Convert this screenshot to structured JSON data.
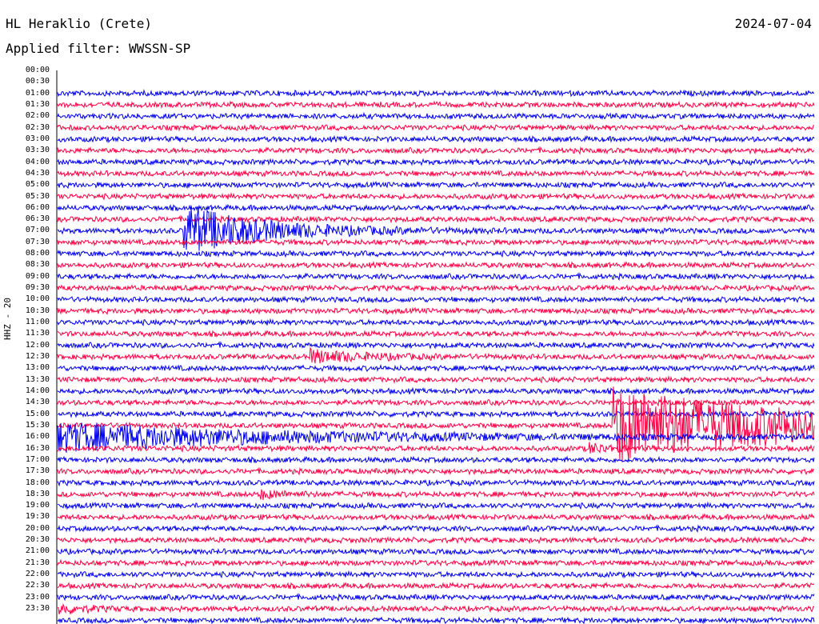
{
  "header": {
    "station": "HL Heraklio (Crete)",
    "date": "2024-07-04",
    "filter_label": "Applied filter:",
    "filter_value": "WWSSN-SP"
  },
  "channel": "HHZ - 20",
  "chart_data": {
    "type": "line",
    "title": "HL Heraklio (Crete)",
    "subtitle": "Applied filter: WWSSN-SP",
    "date": "2024-07-04",
    "ylabel": "HHZ - 20",
    "row_interval_minutes": 30,
    "time_labels": [
      "00:00",
      "00:30",
      "01:00",
      "01:30",
      "02:00",
      "02:30",
      "03:00",
      "03:30",
      "04:00",
      "04:30",
      "05:00",
      "05:30",
      "06:00",
      "06:30",
      "07:00",
      "07:30",
      "08:00",
      "08:30",
      "09:00",
      "09:30",
      "10:00",
      "10:30",
      "11:00",
      "11:30",
      "12:00",
      "12:30",
      "13:00",
      "13:30",
      "14:00",
      "14:30",
      "15:00",
      "15:30",
      "16:00",
      "16:30",
      "17:00",
      "17:30",
      "18:00",
      "18:30",
      "19:00",
      "19:30",
      "20:00",
      "20:30",
      "21:00",
      "21:30",
      "22:00",
      "22:30",
      "23:00",
      "23:30"
    ],
    "trace_colors": [
      "#0000ee",
      "#ff0044"
    ],
    "events": [
      {
        "time": "07:05",
        "relative_amplitude": 8,
        "duration_minutes": 3
      },
      {
        "time": "12:40",
        "relative_amplitude": 2,
        "duration_minutes": 2
      },
      {
        "time": "15:52",
        "relative_amplitude": 12,
        "duration_minutes": 8
      },
      {
        "time": "16:51",
        "relative_amplitude": 1.5,
        "duration_minutes": 1
      },
      {
        "time": "18:38",
        "relative_amplitude": 1.2,
        "duration_minutes": 1
      },
      {
        "time": "23:30",
        "relative_amplitude": 1.5,
        "duration_minutes": 1
      }
    ]
  }
}
